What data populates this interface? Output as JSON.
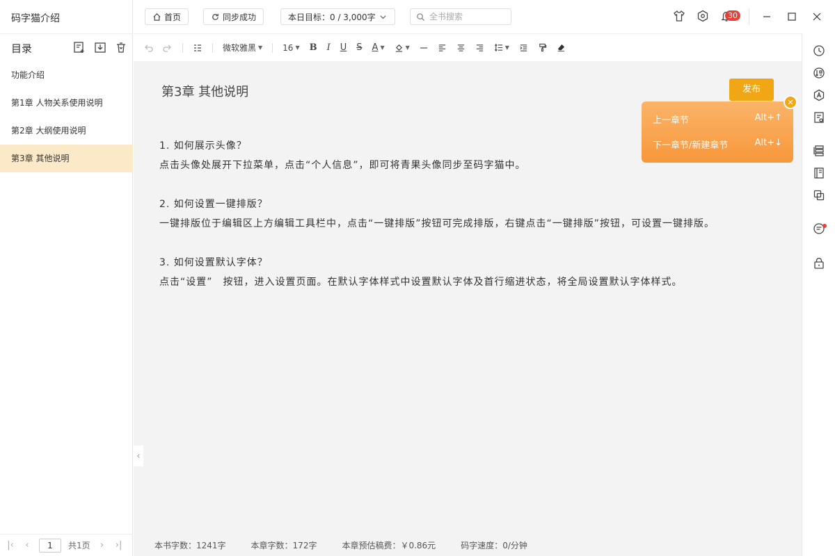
{
  "app": {
    "book_title": "码字猫介绍"
  },
  "toc": {
    "title": "目录",
    "items": [
      {
        "label": "功能介绍",
        "active": false
      },
      {
        "label": "第1章 人物关系使用说明",
        "active": false
      },
      {
        "label": "第2章 大纲使用说明",
        "active": false
      },
      {
        "label": "第3章 其他说明",
        "active": true
      }
    ]
  },
  "pager": {
    "current_page": "1",
    "total_label": "共1页"
  },
  "topbar": {
    "home_label": "首页",
    "sync_label": "同步成功",
    "goal_label": "本日目标：0 / 3,000字",
    "search_placeholder": "全书搜索",
    "notification_count": "30"
  },
  "format": {
    "font_family": "微软雅黑",
    "font_size": "16"
  },
  "editor": {
    "chapter_title": "第3章 其他说明",
    "publish_label": "发布",
    "paragraphs": [
      "1. 如何展示头像？",
      "点击头像处展开下拉菜单，点击“个人信息”，即可将青果头像同步至码字猫中。",
      "",
      "2. 如何设置一键排版？",
      "一键排版位于编辑区上方编辑工具栏中，点击“一键排版”按钮可完成排版，右键点击“一键排版”按钮，可设置一键排版。",
      "",
      "3. 如何设置默认字体？",
      "点击“设置”　按钮，进入设置页面。在默认字体样式中设置默认字体及首行缩进状态，将全局设置默认字体样式。"
    ]
  },
  "nav_popup": {
    "prev_label": "上一章节",
    "prev_shortcut": "Alt+↑",
    "next_label": "下一章节/新建章节",
    "next_shortcut": "Alt+↓"
  },
  "status": {
    "book_words": "本书字数：1241字",
    "chapter_words": "本章字数：172字",
    "fee": "本章预估稿费：￥0.86元",
    "speed": "码字速度：0/分钟"
  },
  "colors": {
    "accent": "#f0a713",
    "popup": "#f7973b",
    "active_item": "#fbe9c8",
    "badge": "#e2433b"
  }
}
